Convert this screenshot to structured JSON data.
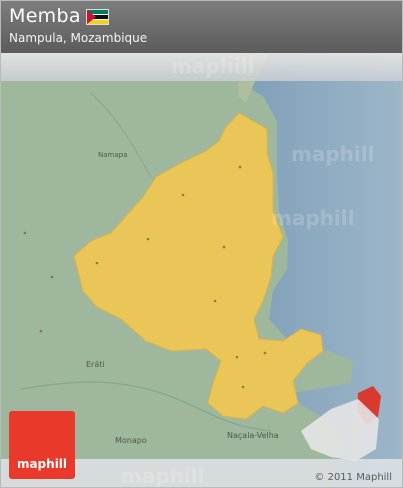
{
  "header": {
    "title": "Memba",
    "subtitle": "Nampula, Mozambique"
  },
  "flag": {
    "name": "mozambique-flag-icon"
  },
  "branding": {
    "logo_text": "maphill",
    "copyright": "© 2011 Maphill"
  },
  "map": {
    "labels": {
      "namapa": "Namapa",
      "erati": "Eráti",
      "monapo": "Monapo",
      "nacala_velha": "Naçala-Velha"
    },
    "colors": {
      "land": "#9fb79d",
      "region": "#e9c657",
      "water": "#7d9db7",
      "highlight": "#d93a2e"
    }
  }
}
